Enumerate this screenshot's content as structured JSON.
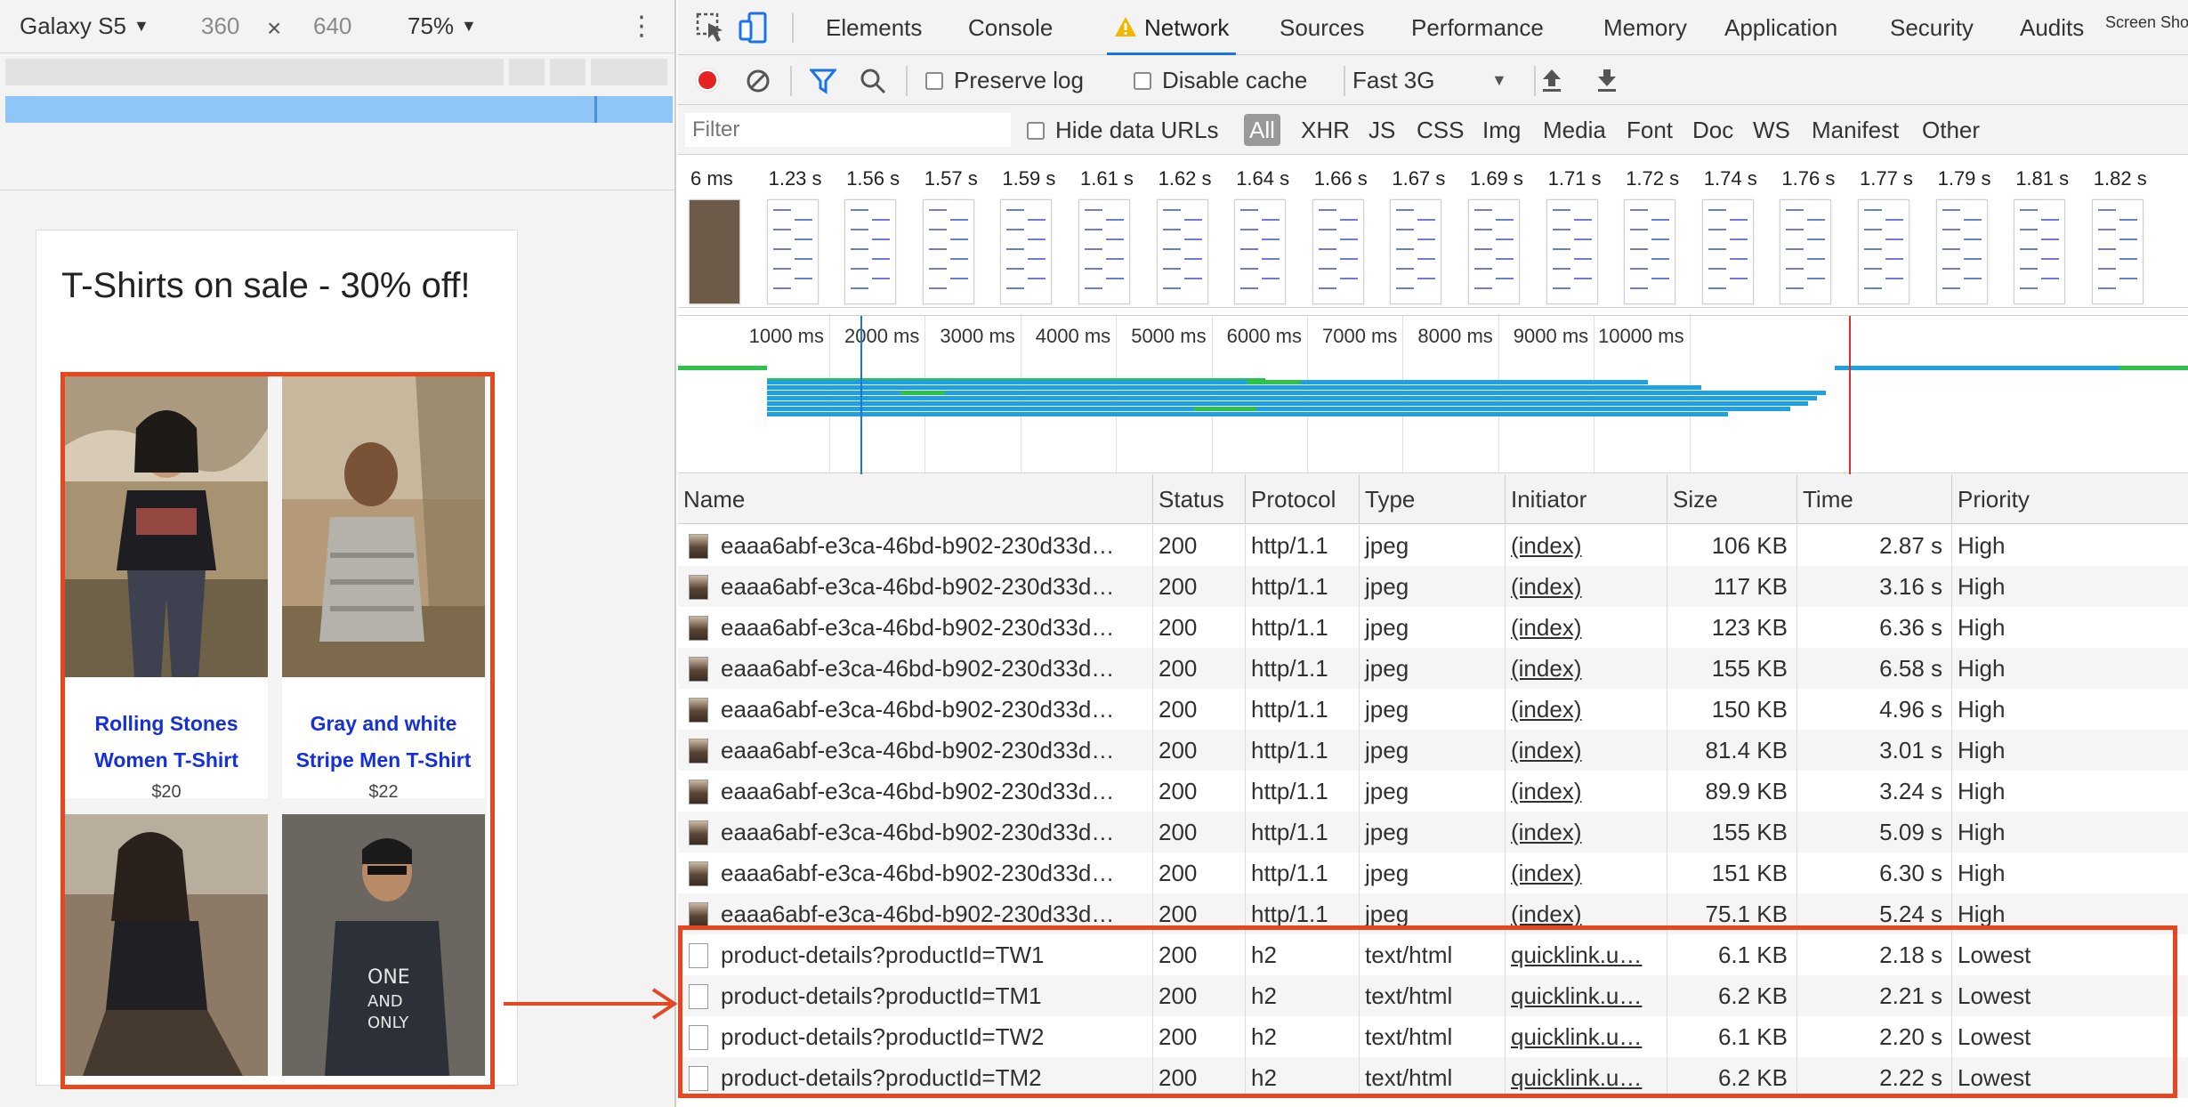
{
  "device_toolbar": {
    "device": "Galaxy S5",
    "width": "360",
    "times": "×",
    "height": "640",
    "zoom": "75%"
  },
  "page": {
    "heading": "T-Shirts on sale - 30% off!",
    "products": [
      {
        "name_line1": "Rolling Stones",
        "name_line2": "Women T-Shirt",
        "price": "$20"
      },
      {
        "name_line1": "Gray and white",
        "name_line2": "Stripe Men T-Shirt",
        "price": "$22"
      }
    ]
  },
  "devtools": {
    "tabs": [
      "Elements",
      "Console",
      "Network",
      "Sources",
      "Performance",
      "Memory",
      "Application",
      "Security",
      "Audits"
    ],
    "active_tab": "Network",
    "overflow_label": "Screen Sho",
    "toolbar": {
      "preserve_log": "Preserve log",
      "disable_cache": "Disable cache",
      "throttling": "Fast 3G"
    },
    "filter": {
      "placeholder": "Filter",
      "hide_data_urls": "Hide data URLs",
      "types": [
        "All",
        "XHR",
        "JS",
        "CSS",
        "Img",
        "Media",
        "Font",
        "Doc",
        "WS",
        "Manifest",
        "Other"
      ]
    },
    "frame_times": [
      "6 ms",
      "1.23 s",
      "1.56 s",
      "1.57 s",
      "1.59 s",
      "1.61 s",
      "1.62 s",
      "1.64 s",
      "1.66 s",
      "1.67 s",
      "1.69 s",
      "1.71 s",
      "1.72 s",
      "1.74 s",
      "1.76 s",
      "1.77 s",
      "1.79 s",
      "1.81 s",
      "1.82 s"
    ],
    "overview_labels": [
      "1000 ms",
      "2000 ms",
      "3000 ms",
      "4000 ms",
      "5000 ms",
      "6000 ms",
      "7000 ms",
      "8000 ms",
      "9000 ms",
      "10000 ms"
    ],
    "columns": [
      "Name",
      "Status",
      "Protocol",
      "Type",
      "Initiator",
      "Size",
      "Time",
      "Priority"
    ],
    "rows": [
      {
        "name": "eaaa6abf-e3ca-46bd-b902-230d33d…",
        "status": "200",
        "protocol": "http/1.1",
        "type": "jpeg",
        "initiator": "(index)",
        "size": "106 KB",
        "time": "2.87 s",
        "priority": "High",
        "icon": "image"
      },
      {
        "name": "eaaa6abf-e3ca-46bd-b902-230d33d…",
        "status": "200",
        "protocol": "http/1.1",
        "type": "jpeg",
        "initiator": "(index)",
        "size": "117 KB",
        "time": "3.16 s",
        "priority": "High",
        "icon": "image"
      },
      {
        "name": "eaaa6abf-e3ca-46bd-b902-230d33d…",
        "status": "200",
        "protocol": "http/1.1",
        "type": "jpeg",
        "initiator": "(index)",
        "size": "123 KB",
        "time": "6.36 s",
        "priority": "High",
        "icon": "image"
      },
      {
        "name": "eaaa6abf-e3ca-46bd-b902-230d33d…",
        "status": "200",
        "protocol": "http/1.1",
        "type": "jpeg",
        "initiator": "(index)",
        "size": "155 KB",
        "time": "6.58 s",
        "priority": "High",
        "icon": "image"
      },
      {
        "name": "eaaa6abf-e3ca-46bd-b902-230d33d…",
        "status": "200",
        "protocol": "http/1.1",
        "type": "jpeg",
        "initiator": "(index)",
        "size": "150 KB",
        "time": "4.96 s",
        "priority": "High",
        "icon": "image"
      },
      {
        "name": "eaaa6abf-e3ca-46bd-b902-230d33d…",
        "status": "200",
        "protocol": "http/1.1",
        "type": "jpeg",
        "initiator": "(index)",
        "size": "81.4 KB",
        "time": "3.01 s",
        "priority": "High",
        "icon": "image"
      },
      {
        "name": "eaaa6abf-e3ca-46bd-b902-230d33d…",
        "status": "200",
        "protocol": "http/1.1",
        "type": "jpeg",
        "initiator": "(index)",
        "size": "89.9 KB",
        "time": "3.24 s",
        "priority": "High",
        "icon": "image"
      },
      {
        "name": "eaaa6abf-e3ca-46bd-b902-230d33d…",
        "status": "200",
        "protocol": "http/1.1",
        "type": "jpeg",
        "initiator": "(index)",
        "size": "155 KB",
        "time": "5.09 s",
        "priority": "High",
        "icon": "image"
      },
      {
        "name": "eaaa6abf-e3ca-46bd-b902-230d33d…",
        "status": "200",
        "protocol": "http/1.1",
        "type": "jpeg",
        "initiator": "(index)",
        "size": "151 KB",
        "time": "6.30 s",
        "priority": "High",
        "icon": "image"
      },
      {
        "name": "eaaa6abf-e3ca-46bd-b902-230d33d…",
        "status": "200",
        "protocol": "http/1.1",
        "type": "jpeg",
        "initiator": "(index)",
        "size": "75.1 KB",
        "time": "5.24 s",
        "priority": "High",
        "icon": "image"
      },
      {
        "name": "product-details?productId=TW1",
        "status": "200",
        "protocol": "h2",
        "type": "text/html",
        "initiator": "quicklink.u…",
        "size": "6.1 KB",
        "time": "2.18 s",
        "priority": "Lowest",
        "icon": "document"
      },
      {
        "name": "product-details?productId=TM1",
        "status": "200",
        "protocol": "h2",
        "type": "text/html",
        "initiator": "quicklink.u…",
        "size": "6.2 KB",
        "time": "2.21 s",
        "priority": "Lowest",
        "icon": "document"
      },
      {
        "name": "product-details?productId=TW2",
        "status": "200",
        "protocol": "h2",
        "type": "text/html",
        "initiator": "quicklink.u…",
        "size": "6.1 KB",
        "time": "2.20 s",
        "priority": "Lowest",
        "icon": "document"
      },
      {
        "name": "product-details?productId=TM2",
        "status": "200",
        "protocol": "h2",
        "type": "text/html",
        "initiator": "quicklink.u…",
        "size": "6.2 KB",
        "time": "2.22 s",
        "priority": "Lowest",
        "icon": "document"
      }
    ]
  },
  "colors": {
    "highlight": "#e8461f",
    "link_blue": "#1530d6",
    "active_tab_underline": "#1a73e8",
    "waterfall_blue": "#1ea1e0",
    "waterfall_green": "#2bc24a",
    "record_red": "#e52222"
  }
}
